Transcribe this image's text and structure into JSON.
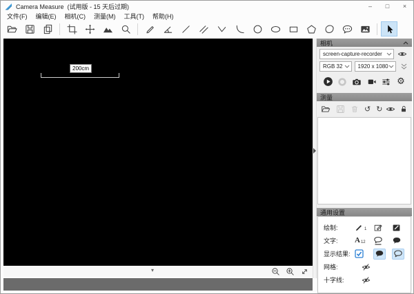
{
  "window": {
    "title": "Camera Measure  (试用版 - 15 天后过期)",
    "minimize_glyph": "–",
    "maximize_glyph": "□",
    "close_glyph": "×"
  },
  "menus": [
    "文件(F)",
    "编辑(E)",
    "相机(C)",
    "测量(M)",
    "工具(T)",
    "帮助(H)"
  ],
  "toolbar": {
    "icons": [
      "open-file",
      "save",
      "copy",
      "crop",
      "pan-move",
      "snapshot-image",
      "magnifier",
      "pencil",
      "angle-measure",
      "line",
      "parallel-lines",
      "polyline",
      "arc",
      "circle",
      "ellipse",
      "rectangle",
      "pentagon",
      "freeform-polygon",
      "comment-bubble",
      "picture",
      "select-cursor"
    ],
    "selected_tool": "select-cursor"
  },
  "canvas": {
    "measurement_label": "200cm",
    "collapse_glyph": "▾"
  },
  "camera_panel": {
    "header": "相机",
    "device": "screen-capture-recorder",
    "pixel_format": "RGB 32",
    "resolution": "1920 x 1080",
    "buttons": [
      "play",
      "stop",
      "snapshot",
      "record-video",
      "adjustments",
      "settings"
    ],
    "gear_glyph": "⚙"
  },
  "measure_panel": {
    "header": "测量",
    "toolbar_icons": [
      "open",
      "save",
      "delete",
      "undo",
      "redo",
      "visibility",
      "lock"
    ],
    "undo_glyph": "↺",
    "redo_glyph": "↻"
  },
  "settings_panel": {
    "header": "通用设置",
    "draw_label": "绘制:",
    "draw_pen_size": "1",
    "text_label": "文字:",
    "text_glyph": "A",
    "text_font_size": "12",
    "results_label": "显示结果:",
    "grid_label": "网格:",
    "crosshair_label": "十字线:"
  },
  "colors": {
    "accent_blue": "#2a7fd4",
    "selection_bg": "#cce4f7",
    "header_gray": "#8b8b8b",
    "canvas_black": "#000000",
    "statusbar_gray": "#6b6b6b"
  }
}
